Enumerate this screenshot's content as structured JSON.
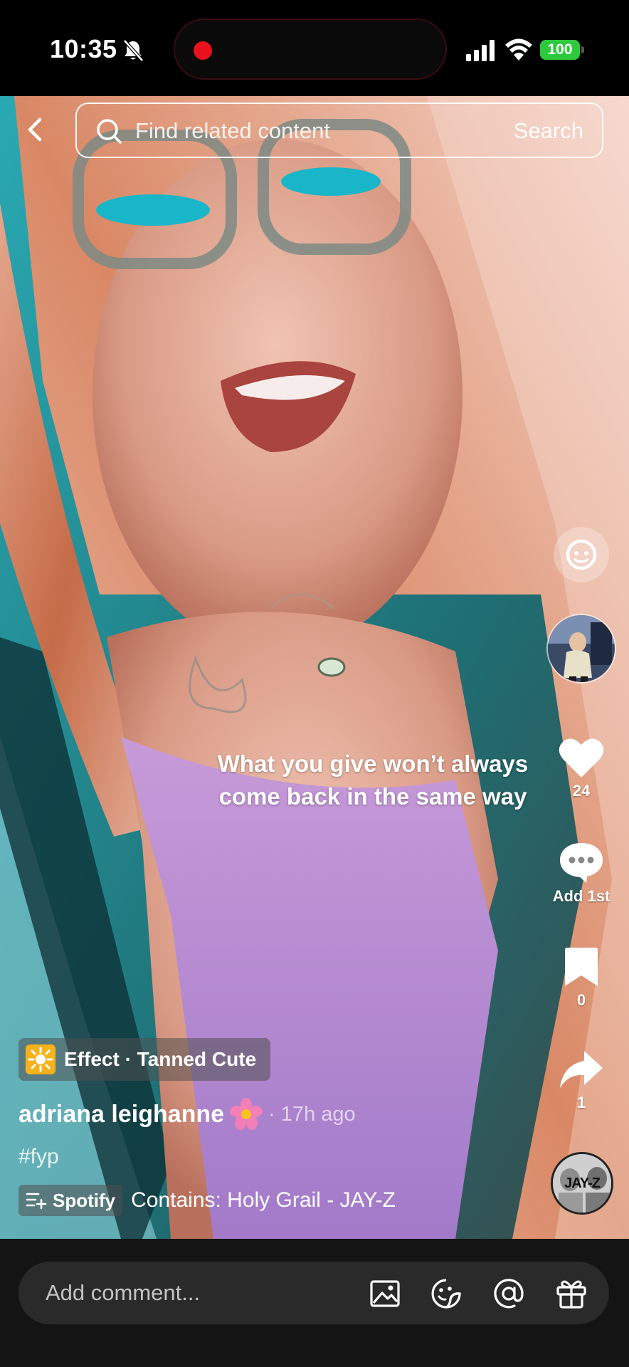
{
  "status_bar": {
    "time": "10:35",
    "battery": "100",
    "icons": [
      "bell-slash-icon",
      "recording-dot-icon",
      "cellular-signal-icon",
      "wifi-icon",
      "battery-icon"
    ],
    "colors": {
      "recording": "#e8121d",
      "battery": "#2ec93c"
    }
  },
  "search": {
    "placeholder": "Find related content",
    "button_label": "Search",
    "icons": [
      "back-chevron-icon",
      "search-icon"
    ]
  },
  "video": {
    "caption": "What you give won’t always come back in the same way"
  },
  "rail": {
    "likes": "24",
    "comments": "Add 1st",
    "saves": "0",
    "shares": "1",
    "music_disc_text": "JAY-Z",
    "icons": [
      "face-effect-icon",
      "creator-avatar",
      "heart-icon",
      "comment-bubble-icon",
      "bookmark-icon",
      "share-arrow-icon",
      "music-disc"
    ]
  },
  "post": {
    "effect_label": "Effect · Tanned Cute",
    "username": "adriana leighanne",
    "timestamp": "· 17h ago",
    "hashtag": "#fyp",
    "spotify_label": "Spotify",
    "music_text": "Contains: Holy Grail - JAY-Z",
    "icons": [
      "sparkle-effect-icon",
      "flower-emoji-icon",
      "add-to-playlist-icon"
    ]
  },
  "comment_bar": {
    "placeholder": "Add comment...",
    "icons": [
      "image-icon",
      "emoji-sticker-icon",
      "at-mention-icon",
      "gift-icon"
    ]
  }
}
